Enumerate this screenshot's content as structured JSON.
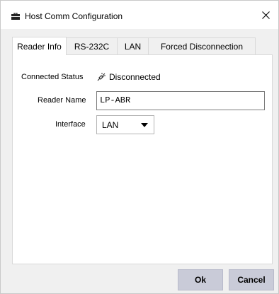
{
  "window": {
    "title": "Host Comm Configuration",
    "close_glyph": "✕"
  },
  "tabs": [
    {
      "label": "Reader Info",
      "active": true
    },
    {
      "label": "RS-232C",
      "active": false
    },
    {
      "label": "LAN",
      "active": false
    },
    {
      "label": "Forced Disconnection",
      "active": false
    }
  ],
  "reader_info": {
    "connected_status_label": "Connected Status",
    "connected_status_value": "Disconnected",
    "connected_status_icon": "disconnected-plug-icon",
    "reader_name_label": "Reader Name",
    "reader_name_value": "LP-ABR",
    "interface_label": "Interface",
    "interface_value": "LAN"
  },
  "buttons": {
    "ok_label": "Ok",
    "cancel_label": "Cancel"
  },
  "colors": {
    "button_bg": "#c9cbd8",
    "window_bg": "#f0f0f0"
  }
}
